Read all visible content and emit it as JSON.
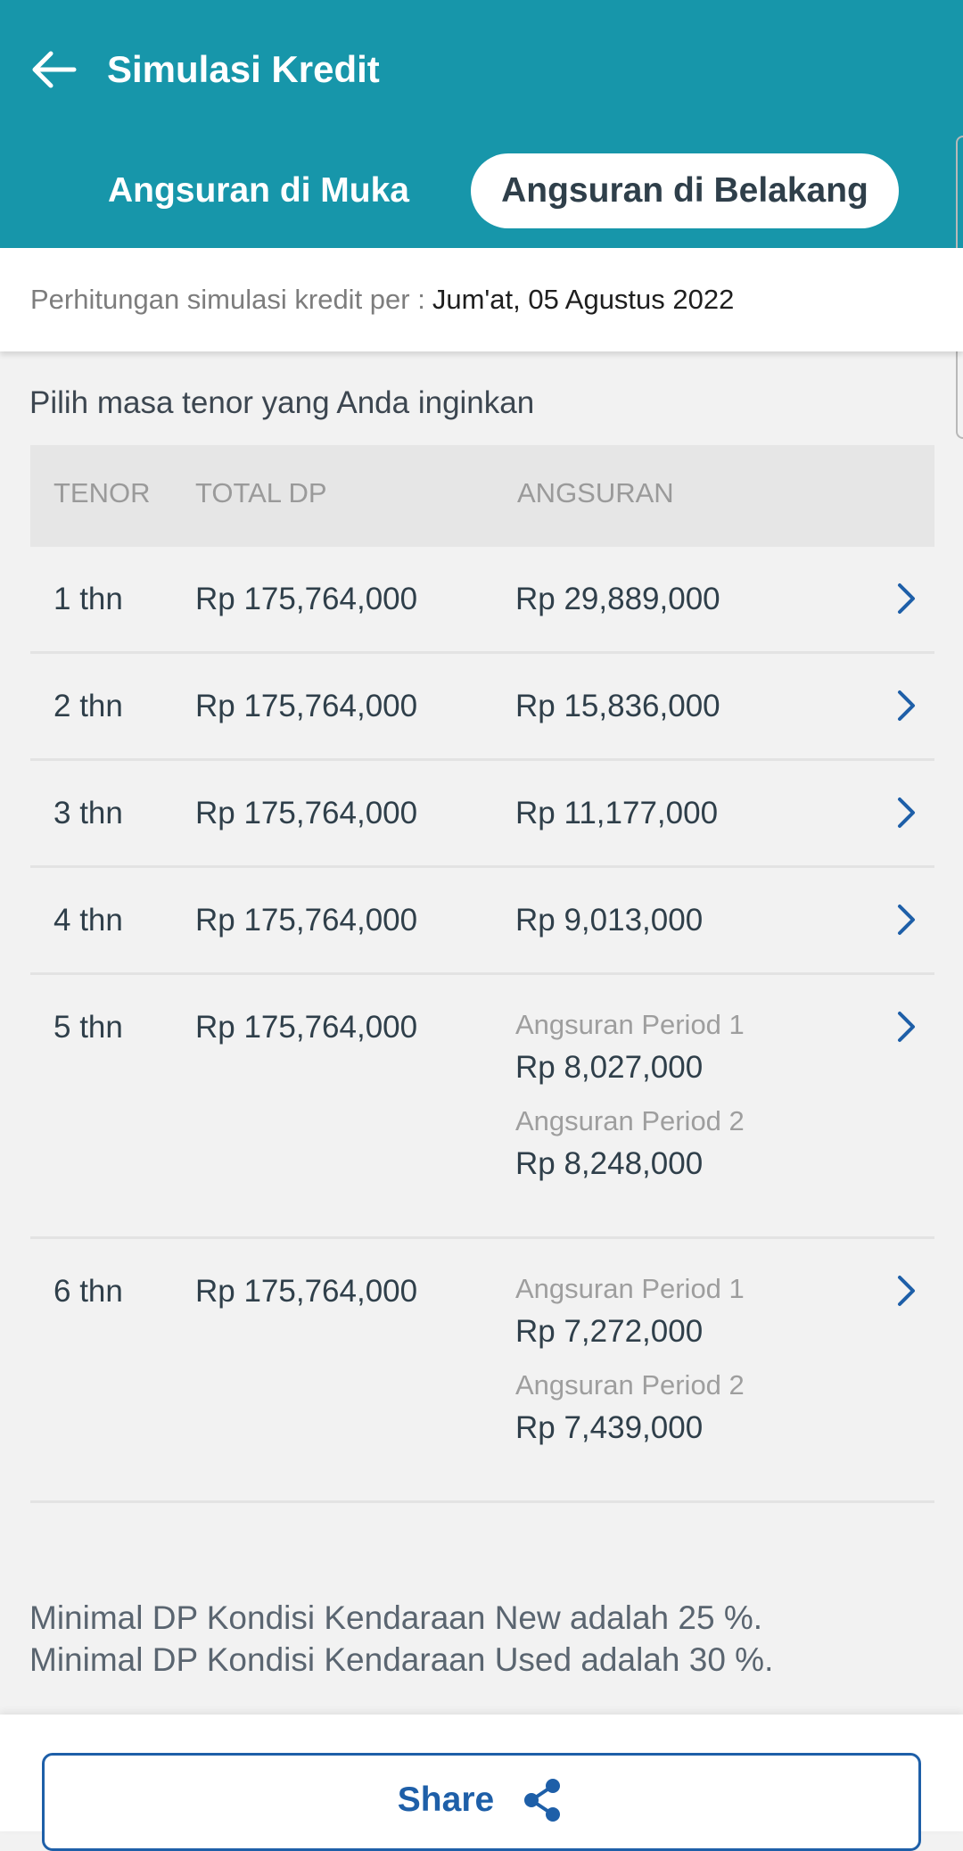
{
  "header": {
    "title": "Simulasi Kredit",
    "back_icon": "arrow-left-icon",
    "tabs": [
      {
        "label": "Angsuran di Muka",
        "active": false
      },
      {
        "label": "Angsuran di Belakang",
        "active": true
      }
    ]
  },
  "date_bar": {
    "label": "Perhitungan simulasi kredit per :",
    "value": "Jum'at, 05 Agustus 2022"
  },
  "section": {
    "title": "Pilih masa tenor yang Anda inginkan"
  },
  "table": {
    "columns": [
      "TENOR",
      "TOTAL DP",
      "ANGSURAN"
    ],
    "rows": [
      {
        "tenor": "1 thn",
        "dp": "Rp 175,764,000",
        "angsuran": "Rp 29,889,000"
      },
      {
        "tenor": "2 thn",
        "dp": "Rp 175,764,000",
        "angsuran": "Rp 15,836,000"
      },
      {
        "tenor": "3 thn",
        "dp": "Rp 175,764,000",
        "angsuran": "Rp 11,177,000"
      },
      {
        "tenor": "4 thn",
        "dp": "Rp 175,764,000",
        "angsuran": "Rp 9,013,000"
      },
      {
        "tenor": "5 thn",
        "dp": "Rp 175,764,000",
        "p1_label": "Angsuran Period 1",
        "p1_value": "Rp 8,027,000",
        "p2_label": "Angsuran Period 2",
        "p2_value": "Rp 8,248,000"
      },
      {
        "tenor": "6 thn",
        "dp": "Rp 175,764,000",
        "p1_label": "Angsuran Period 1",
        "p1_value": "Rp 7,272,000",
        "p2_label": "Angsuran Period 2",
        "p2_value": "Rp 7,439,000"
      }
    ]
  },
  "notes": [
    "Minimal DP Kondisi Kendaraan New adalah 25 %.",
    "Minimal DP Kondisi Kendaraan Used adalah 30 %."
  ],
  "share": {
    "label": "Share",
    "icon": "share-icon"
  },
  "colors": {
    "header": "#1796aa",
    "accent": "#1e5fa8"
  }
}
